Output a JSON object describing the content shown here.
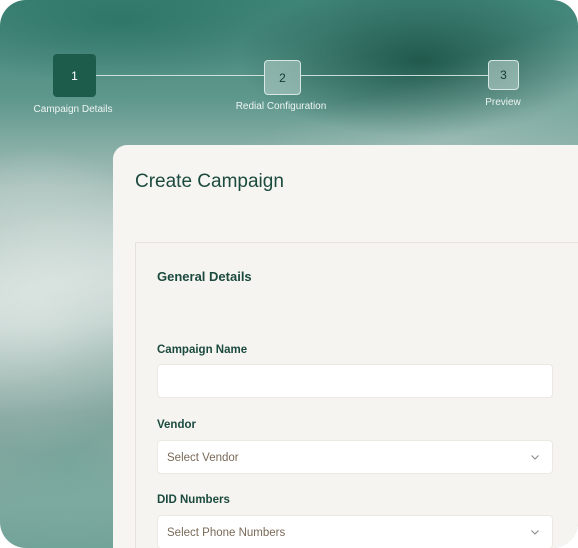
{
  "stepper": {
    "steps": [
      {
        "number": "1",
        "label": "Campaign Details",
        "active": true
      },
      {
        "number": "2",
        "label": "Redial Configuration",
        "active": false
      },
      {
        "number": "3",
        "label": "Preview",
        "active": false
      }
    ]
  },
  "form": {
    "title": "Create Campaign",
    "section_title": "General Details",
    "campaign_name": {
      "label": "Campaign Name",
      "value": "",
      "placeholder": ""
    },
    "vendor": {
      "label": "Vendor",
      "placeholder": "Select Vendor"
    },
    "did_numbers": {
      "label": "DID Numbers",
      "placeholder": "Select Phone Numbers"
    }
  },
  "colors": {
    "accent": "#1d5b4b",
    "heading": "#1b4a3f",
    "placeholder": "#7a6a58"
  }
}
